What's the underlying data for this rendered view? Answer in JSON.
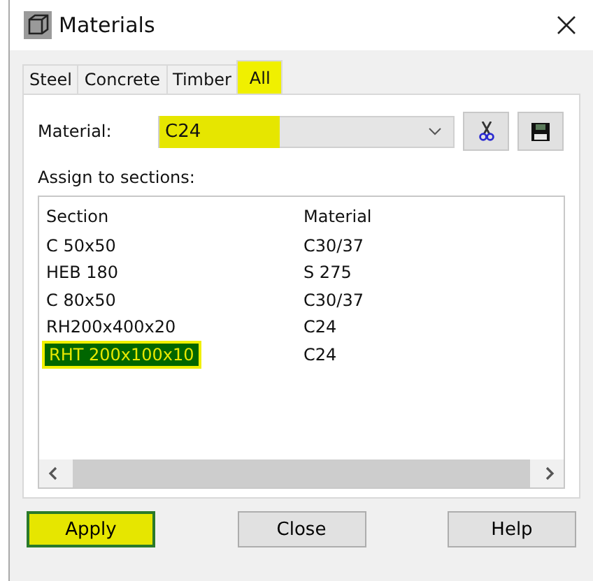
{
  "window": {
    "title": "Materials"
  },
  "tabs": [
    {
      "label": "Steel",
      "selected": false,
      "highlighted": false
    },
    {
      "label": "Concrete",
      "selected": false,
      "highlighted": false
    },
    {
      "label": "Timber",
      "selected": false,
      "highlighted": false
    },
    {
      "label": "All",
      "selected": true,
      "highlighted": true
    }
  ],
  "material": {
    "label": "Material:",
    "value": "C24",
    "highlighted": true
  },
  "assign_label": "Assign to sections:",
  "table": {
    "columns": [
      "Section",
      "Material"
    ],
    "rows": [
      {
        "cells": [
          "C 50x50",
          "C30/37"
        ],
        "selected": false
      },
      {
        "cells": [
          "HEB 180",
          "S 275"
        ],
        "selected": false
      },
      {
        "cells": [
          "C 80x50",
          "C30/37"
        ],
        "selected": false
      },
      {
        "cells": [
          "RH200x400x20",
          "C24"
        ],
        "selected": false
      },
      {
        "cells": [
          "RHT 200x100x10",
          "C24"
        ],
        "selected": true
      }
    ]
  },
  "buttons": [
    {
      "label": "Apply",
      "highlighted": true
    },
    {
      "label": "Close",
      "highlighted": false
    },
    {
      "label": "Help",
      "highlighted": false
    }
  ]
}
